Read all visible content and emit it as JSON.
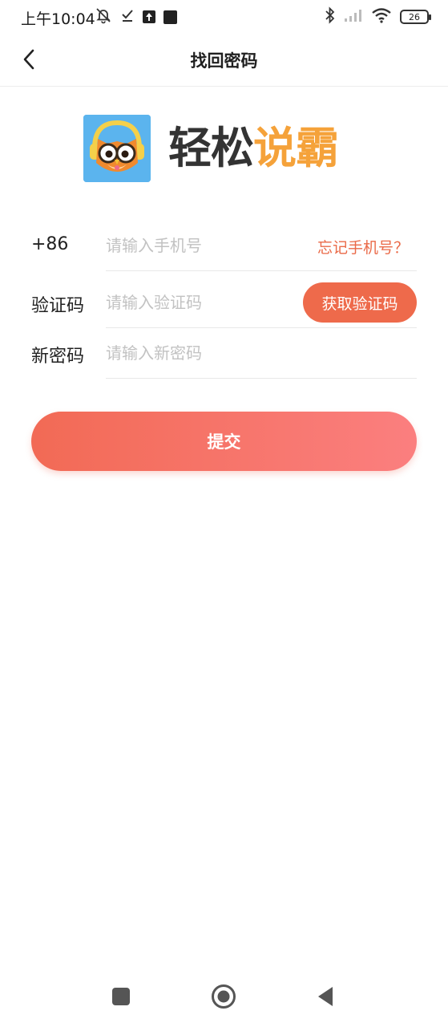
{
  "status_bar": {
    "time": "上午10:04",
    "battery": "26",
    "icons": [
      "mute-bell-icon",
      "check-icon",
      "upload-icon",
      "square-icon",
      "bluetooth-icon",
      "signal-icon",
      "wifi-icon",
      "battery-icon"
    ]
  },
  "nav": {
    "title": "找回密码",
    "back_icon": "chevron-left-icon"
  },
  "logo": {
    "text_dark": "轻松",
    "text_orange": "说霸",
    "badge_icon": "owl-headphones-icon"
  },
  "form": {
    "phone": {
      "label": "+86",
      "placeholder": "请输入手机号",
      "value": "",
      "forgot_link": "忘记手机号？"
    },
    "code": {
      "label": "验证码",
      "placeholder": "请输入验证码",
      "value": "",
      "button": "获取验证码"
    },
    "password": {
      "label": "新密码",
      "placeholder": "请输入新密码",
      "value": ""
    },
    "submit": "提交"
  },
  "system_nav": {
    "items": [
      "recent-apps-icon",
      "home-icon",
      "back-icon"
    ]
  },
  "colors": {
    "accent": "#ee6a4b",
    "submit_start": "#f26a55",
    "submit_end": "#fb7f7f",
    "logo_orange": "#f5a23a",
    "logo_dark": "#333333",
    "badge_blue": "#5bb4ee"
  }
}
